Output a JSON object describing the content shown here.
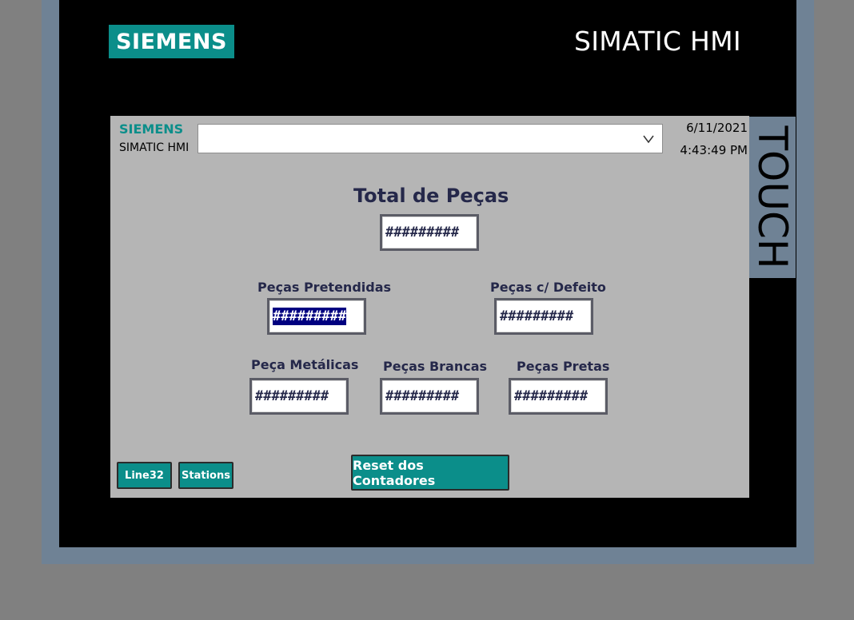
{
  "bezel": {
    "brand": "SIEMENS",
    "model": "SIMATIC HMI",
    "side_label": "TOUCH"
  },
  "header": {
    "brand": "SIEMENS",
    "subtitle": "SIMATIC HMI",
    "date": "6/11/2021",
    "time": "4:43:49 PM",
    "screen_selector_value": ""
  },
  "counters": {
    "total": {
      "label": "Total de Peças",
      "value": "#########"
    },
    "pretendidas": {
      "label": "Peças Pretendidas",
      "value": "#########"
    },
    "defeito": {
      "label": "Peças c/ Defeito",
      "value": "#########"
    },
    "metalicas": {
      "label": "Peça Metálicas",
      "value": "#########"
    },
    "brancas": {
      "label": "Peças Brancas",
      "value": "#########"
    },
    "pretas": {
      "label": "Peças Pretas",
      "value": "#########"
    }
  },
  "buttons": {
    "line32": "Line32",
    "stations": "Stations",
    "reset": "Reset dos Contadores"
  },
  "colors": {
    "accent": "#0b8e8a",
    "screen_bg": "#b5b5b5",
    "frame": "#6f8295"
  }
}
